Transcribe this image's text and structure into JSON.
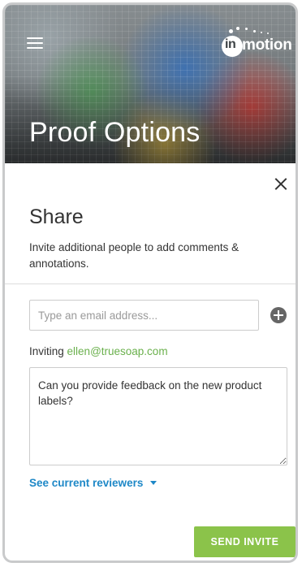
{
  "header": {
    "logo_text": "inmotion",
    "title": "Proof Options"
  },
  "share": {
    "heading": "Share",
    "description": "Invite additional people to add comments & annotations.",
    "email_placeholder": "Type an email address...",
    "inviting_label": "Inviting",
    "inviting_email": "ellen@truesoap.com",
    "message": "Can you provide feedback on the new product labels?",
    "reviewers_link": "See current reviewers",
    "send_label": "SEND INVITE"
  },
  "icons": {
    "menu": "menu-icon",
    "close": "close-icon",
    "add": "plus-circle-icon",
    "caret": "caret-down-icon"
  },
  "colors": {
    "accent_green": "#8bc34a",
    "link_blue": "#1e88c7",
    "email_green": "#6ab04c"
  }
}
